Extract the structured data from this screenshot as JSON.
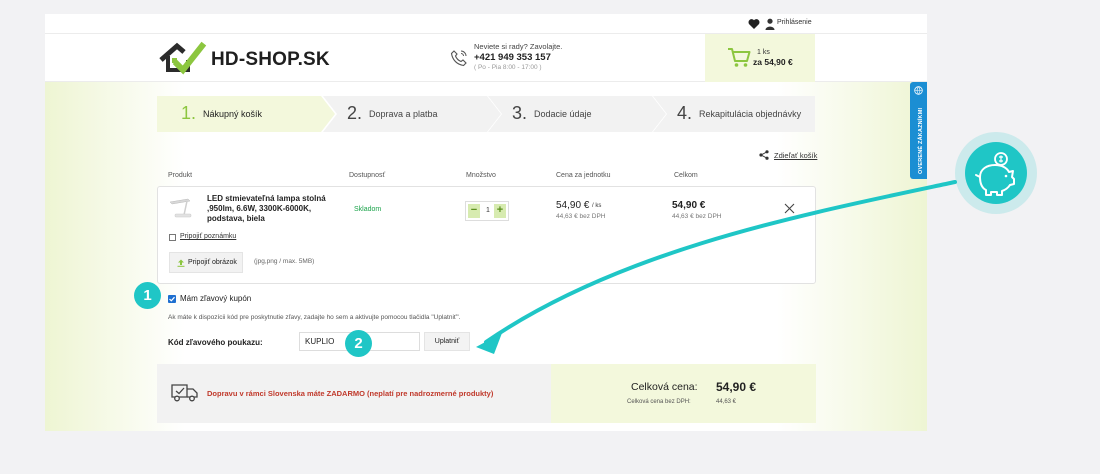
{
  "topbar": {
    "login": "Prihlásenie"
  },
  "header": {
    "logo_text": "HD-SHOP.SK",
    "contact_question": "Neviete si rady? Zavolajte.",
    "contact_phone": "+421 949 353 157",
    "contact_hours": "( Po - Pia 8:00 - 17:00 )",
    "cart_count": "1 ks",
    "cart_total": "za 54,90 €"
  },
  "steps": [
    {
      "num": "1.",
      "label": "Nákupný košík"
    },
    {
      "num": "2.",
      "label": "Doprava a platba"
    },
    {
      "num": "3.",
      "label": "Dodacie údaje"
    },
    {
      "num": "4.",
      "label": "Rekapitulácia objednávky"
    }
  ],
  "share_label": "Zdieľať košík",
  "table_headers": {
    "product": "Produkt",
    "availability": "Dostupnosť",
    "quantity": "Množstvo",
    "unit_price": "Cena za jednotku",
    "total": "Celkom"
  },
  "item": {
    "name": "LED stmievateľná lampa stolná ,950lm, 6.6W, 3300K-6000K, podstava, biela",
    "availability": "Skladom",
    "quantity": "1",
    "unit_price": "54,90 €",
    "unit_suffix": "/ ks",
    "unit_price_nodph": "44,63 € bez DPH",
    "total_price": "54,90 €",
    "total_nodph": "44,63 € bez DPH",
    "add_note": "Pripojiť poznámku",
    "attach_image": "Pripojiť obrázok",
    "attach_hint": "(jpg,png / max. 5MB)"
  },
  "coupon": {
    "checkbox_label": "Mám zľavový kupón",
    "help_text": "Ak máte k dispozícii kód pre poskytnutie zľavy, zadajte ho sem a aktivujte pomocou tlačidla \"Uplatniť\".",
    "code_label": "Kód zľavového poukazu:",
    "code_value": "KUPLIO",
    "apply_label": "Uplatniť"
  },
  "shipping_notice": "Dopravu v rámci Slovenska máte ZADARMO (neplatí pre nadrozmerné produkty)",
  "totals": {
    "grand_label": "Celková cena:",
    "grand_value": "54,90 €",
    "nodph_label": "Celková cena bez DPH:",
    "nodph_value": "44,63 €"
  },
  "review_tab": "OVERENÉ ZÁKAZNÍKMI",
  "markers": [
    "1",
    "2"
  ],
  "colors": {
    "accent_green": "#8cc63f",
    "teal_annotation": "#1fc6c6",
    "stock_green": "#1aa34a",
    "shipping_red": "#c0392b",
    "review_blue": "#1b8ed3"
  },
  "icons": [
    "heart-icon",
    "user-icon",
    "phone-icon",
    "cart-icon",
    "share-icon",
    "close-icon",
    "upload-icon",
    "truck-icon",
    "piggy-bank-icon",
    "globe-icon"
  ]
}
